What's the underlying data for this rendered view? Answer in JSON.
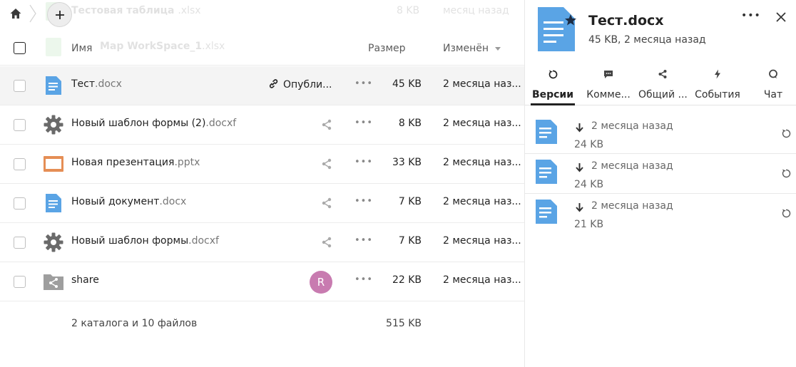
{
  "ghost_rows": [
    {
      "name": "Тестовая таблица",
      "ext": ".xlsx",
      "size": "8 KB",
      "date": "месяц назад"
    },
    {
      "name": "Map WorkSpace_1",
      "ext": ".xlsx"
    }
  ],
  "breadcrumb": {
    "home_icon": "home-icon",
    "add_icon": "plus-icon"
  },
  "header": {
    "name_label": "Имя",
    "size_label": "Размер",
    "modified_label": "Изменён"
  },
  "rows": [
    {
      "name": "Тест",
      "ext": ".docx",
      "size": "45 KB",
      "date": "2 месяца наз...",
      "icon": "document-icon",
      "publish_label": "Опубли...",
      "selected": true
    },
    {
      "name": "Новый шаблон формы (2)",
      "ext": ".docxf",
      "size": "8 KB",
      "date": "2 месяца наз...",
      "icon": "form-template-gear-icon"
    },
    {
      "name": "Новая презентация",
      "ext": ".pptx",
      "size": "33 KB",
      "date": "2 месяца наз...",
      "icon": "presentation-icon"
    },
    {
      "name": "Новый документ",
      "ext": ".docx",
      "size": "7 KB",
      "date": "2 месяца наз...",
      "icon": "document-icon"
    },
    {
      "name": "Новый шаблон формы",
      "ext": ".docxf",
      "size": "7 KB",
      "date": "2 месяца наз...",
      "icon": "form-template-gear-icon"
    },
    {
      "name": "share",
      "ext": "",
      "size": "22 KB",
      "date": "2 месяца наз...",
      "icon": "shared-folder-icon",
      "avatar_letter": "R"
    }
  ],
  "summary": {
    "text": "2 каталога и 10 файлов",
    "total_size": "515 KB"
  },
  "sidebar": {
    "title": "Тест.docx",
    "subtitle": "45 KB, 2 месяца назад",
    "tabs": [
      {
        "label": "Версии",
        "icon": "restore-icon",
        "active": true
      },
      {
        "label": "Комме...",
        "icon": "comment-icon"
      },
      {
        "label": "Общий ...",
        "icon": "share-icon"
      },
      {
        "label": "События",
        "icon": "lightning-icon"
      },
      {
        "label": "Чат",
        "icon": "chat-icon"
      }
    ],
    "versions": [
      {
        "date": "2 месяца назад",
        "size": "24 KB"
      },
      {
        "date": "2 месяца назад",
        "size": "24 KB"
      },
      {
        "date": "2 месяца назад",
        "size": "21 KB"
      }
    ]
  },
  "colors": {
    "doc_blue": "#5aa4e5",
    "presentation_orange": "#e58e55",
    "gear_gray": "#6a6a6a",
    "folder_gray": "#9e9e9e",
    "avatar": "#c87bb0",
    "selected_row": "#f4f4f4"
  }
}
